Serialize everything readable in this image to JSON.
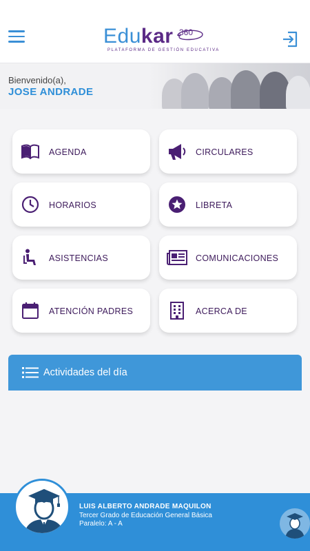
{
  "header": {
    "logo_main": "Edu",
    "logo_accent": "kar",
    "logo_badge": "360",
    "logo_tagline": "PLATAFORMA DE GESTIÓN EDUCATIVA"
  },
  "welcome": {
    "greeting": "Bienvenido(a),",
    "user_name": "JOSE ANDRADE"
  },
  "menu": [
    {
      "label": "AGENDA",
      "icon": "book-icon"
    },
    {
      "label": "CIRCULARES",
      "icon": "megaphone-icon"
    },
    {
      "label": "HORARIOS",
      "icon": "clock-icon"
    },
    {
      "label": "LIBRETA",
      "icon": "star-icon"
    },
    {
      "label": "ASISTENCIAS",
      "icon": "seated-person-icon"
    },
    {
      "label": "COMUNICACIONES",
      "icon": "newspaper-icon"
    },
    {
      "label": "ATENCIÓN PADRES",
      "icon": "calendar-icon"
    },
    {
      "label": "ACERCA DE",
      "icon": "building-icon"
    }
  ],
  "activities": {
    "title": "Actividades del día"
  },
  "student": {
    "name": "LUIS ALBERTO ANDRADE MAQUILON",
    "grade": "Tercer Grado de Educación General Básica",
    "parallel": "Paralelo: A - A"
  },
  "colors": {
    "primary_blue": "#2f8fd8",
    "brand_purple": "#5b2a86",
    "card_text": "#3d1a5b"
  }
}
